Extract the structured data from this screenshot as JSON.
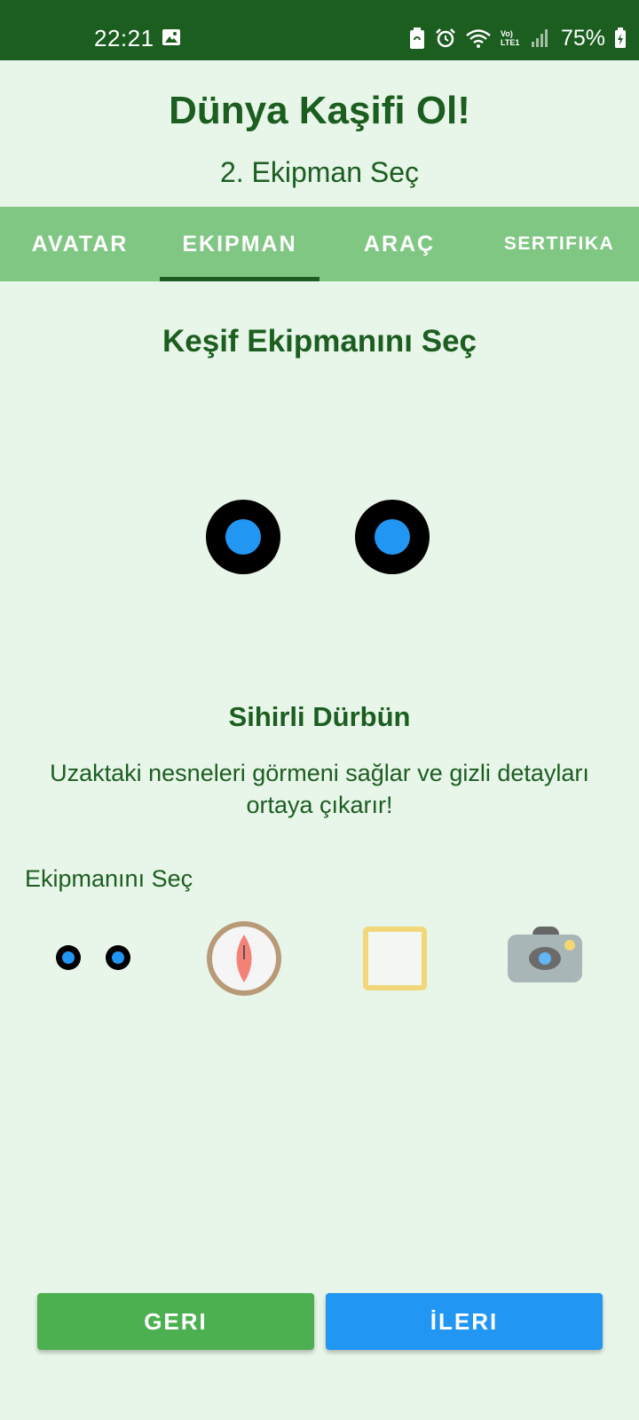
{
  "status_bar": {
    "time": "22:21",
    "battery": "75%",
    "network_label": "Vo) LTE1",
    "icons": [
      "image-icon",
      "battery-saver-icon",
      "alarm-icon",
      "wifi-icon",
      "signal-icon",
      "battery-icon"
    ]
  },
  "header": {
    "title": "Dünya Kaşifi Ol!",
    "subtitle": "2. Ekipman Seç"
  },
  "tabs": [
    {
      "label": "AVATAR",
      "selected": false
    },
    {
      "label": "EKIPMAN",
      "selected": true
    },
    {
      "label": "ARAÇ",
      "selected": false
    },
    {
      "label": "SERTIFIKA",
      "selected": false
    }
  ],
  "main": {
    "section_title": "Keşif Ekipmanını Seç",
    "selected_equipment": {
      "name": "Sihirli Dürbün",
      "description": "Uzaktaki nesneleri görmeni sağlar ve gizli detayları ortaya çıkarır!",
      "icon": "binoculars-icon"
    },
    "picker_label": "Ekipmanını Seç",
    "picker_items": [
      "binoculars-icon",
      "compass-icon",
      "map-icon",
      "camera-icon"
    ]
  },
  "buttons": {
    "back": "GERI",
    "next": "İLERI"
  },
  "colors": {
    "status_bar": "#1b5e20",
    "background": "#e8f5e9",
    "primary_text": "#1b5e20",
    "tab_bar": "#81c784",
    "back_button": "#4caf50",
    "next_button": "#2196f3"
  }
}
